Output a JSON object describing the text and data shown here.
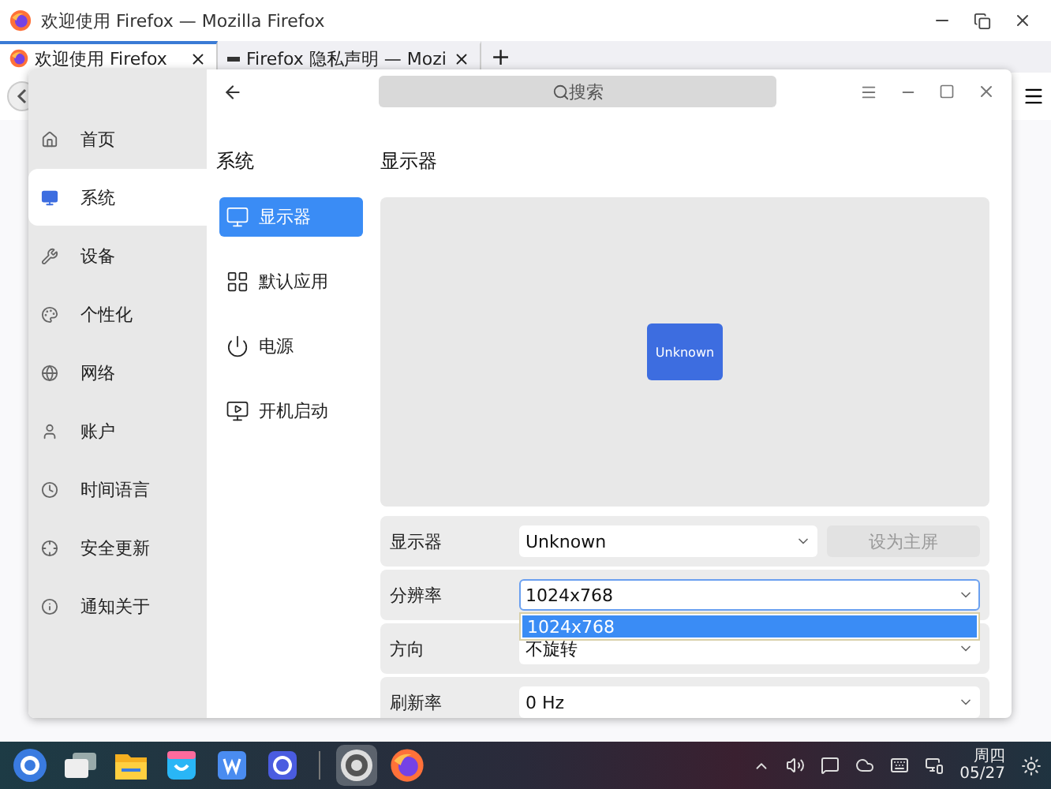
{
  "firefox": {
    "title": "欢迎使用 Firefox — Mozilla Firefox",
    "tabs": [
      {
        "label": "欢迎使用 Firefox",
        "selected": true
      },
      {
        "label": "Firefox 隐私声明 — Mozi",
        "selected": false
      }
    ],
    "new_tab": "+"
  },
  "settings": {
    "search": {
      "placeholder": "搜索"
    },
    "sidebar": [
      {
        "label": "首页",
        "selected": false
      },
      {
        "label": "系统",
        "selected": true
      },
      {
        "label": "设备",
        "selected": false
      },
      {
        "label": "个性化",
        "selected": false
      },
      {
        "label": "网络",
        "selected": false
      },
      {
        "label": "账户",
        "selected": false
      },
      {
        "label": "时间语言",
        "selected": false
      },
      {
        "label": "安全更新",
        "selected": false
      },
      {
        "label": "通知关于",
        "selected": false
      }
    ],
    "category": {
      "title": "系统",
      "items": [
        {
          "label": "显示器",
          "selected": true
        },
        {
          "label": "默认应用",
          "selected": false
        },
        {
          "label": "电源",
          "selected": false
        },
        {
          "label": "开机启动",
          "selected": false
        }
      ]
    },
    "page": {
      "title": "显示器",
      "monitors": [
        {
          "label": "Unknown"
        }
      ],
      "rows": [
        {
          "kind": "select-button",
          "label": "显示器",
          "value": "Unknown",
          "expanded": false,
          "button": {
            "label": "设为主屏",
            "disabled": true
          }
        },
        {
          "kind": "select",
          "label": "分辨率",
          "value": "1024x768",
          "expanded": true,
          "options": [
            {
              "label": "1024x768",
              "selected": true
            }
          ]
        },
        {
          "kind": "select",
          "label": "方向",
          "value": "不旋转",
          "expanded": false
        },
        {
          "kind": "select",
          "label": "刷新率",
          "value": "0 Hz",
          "expanded": false
        }
      ]
    }
  },
  "taskbar": {
    "apps": [
      {
        "kind": "launcher",
        "active": false
      },
      {
        "kind": "windows",
        "active": false
      },
      {
        "kind": "folder",
        "active": false
      },
      {
        "kind": "store",
        "active": false
      },
      {
        "kind": "writer",
        "active": false
      },
      {
        "kind": "search",
        "active": false
      },
      {
        "kind": "settings",
        "active": true
      },
      {
        "kind": "firefox",
        "active": false
      }
    ],
    "day": "周四",
    "date": "05/27"
  }
}
